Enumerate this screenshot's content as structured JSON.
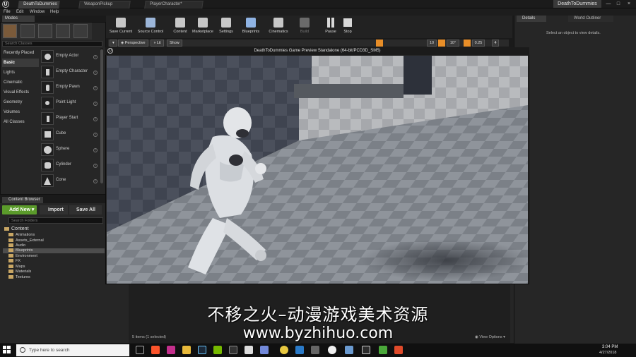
{
  "window": {
    "doc_tabs": [
      "DeathToDummies",
      "WeaponPickup",
      "PlayerCharacter*"
    ],
    "project_name": "DeathToDummies",
    "controls": [
      "—",
      "□",
      "×"
    ]
  },
  "menu": [
    "File",
    "Edit",
    "Window",
    "Help"
  ],
  "modes": {
    "tab_label": "Modes",
    "search_placeholder": "Search Classes",
    "categories": [
      "Recently Placed",
      "Basic",
      "Lights",
      "Cinematic",
      "Visual Effects",
      "Geometry",
      "Volumes",
      "All Classes"
    ],
    "active_category": "Basic",
    "place_items": [
      "Empty Actor",
      "Empty Character",
      "Empty Pawn",
      "Point Light",
      "Player Start",
      "Cube",
      "Sphere",
      "Cylinder",
      "Cone"
    ]
  },
  "toolbar": {
    "buttons": [
      {
        "label": "Save Current",
        "icon": "save-icon"
      },
      {
        "label": "Source Control",
        "icon": "source-control-icon"
      },
      {
        "label": "Content",
        "icon": "content-icon"
      },
      {
        "label": "Marketplace",
        "icon": "marketplace-icon"
      },
      {
        "label": "Settings",
        "icon": "settings-icon"
      },
      {
        "label": "Blueprints",
        "icon": "blueprints-icon"
      },
      {
        "label": "Cinematics",
        "icon": "cinematics-icon"
      },
      {
        "label": "Build",
        "icon": "build-icon"
      },
      {
        "label": "Pause",
        "icon": "pause-icon"
      },
      {
        "label": "Stop",
        "icon": "stop-icon"
      }
    ]
  },
  "viewport_bar": {
    "perspective": "Perspective",
    "lit": "Lit",
    "show": "Show",
    "grid": "10",
    "angle": "10°",
    "scale": "0.25",
    "camera_speed": "4"
  },
  "pie": {
    "title": "DeathToDummies Game Preview Standalone (64-bit/PCD3D_SM5)"
  },
  "details": {
    "tab": "Details",
    "outliner_tab": "World Outliner",
    "hint": "Select an object to view details."
  },
  "content_browser": {
    "tab_label": "Content Browser",
    "add_new": "Add New",
    "import": "Import",
    "save_all": "Save All",
    "search_placeholder": "Search Folders",
    "root": "Content",
    "folders": [
      "Animations",
      "Assets_External",
      "Audio",
      "Blueprints",
      "Environment",
      "FX",
      "Maps",
      "Materials",
      "Textures"
    ],
    "selected_folder": "Blueprints",
    "items_status": "5 items (1 selected)",
    "view_options": "View Options"
  },
  "watermark": {
    "chinese": "不移之火–动漫游戏美术资源",
    "url": "www.byzhihuo.com"
  },
  "taskbar": {
    "search_placeholder": "Type here to search",
    "time": "3:04 PM",
    "date": "4/27/2018"
  },
  "colors": {
    "add_new_green": "#5b9b2b",
    "snap_orange": "#e88e28",
    "folder_tan": "#c8a664"
  }
}
